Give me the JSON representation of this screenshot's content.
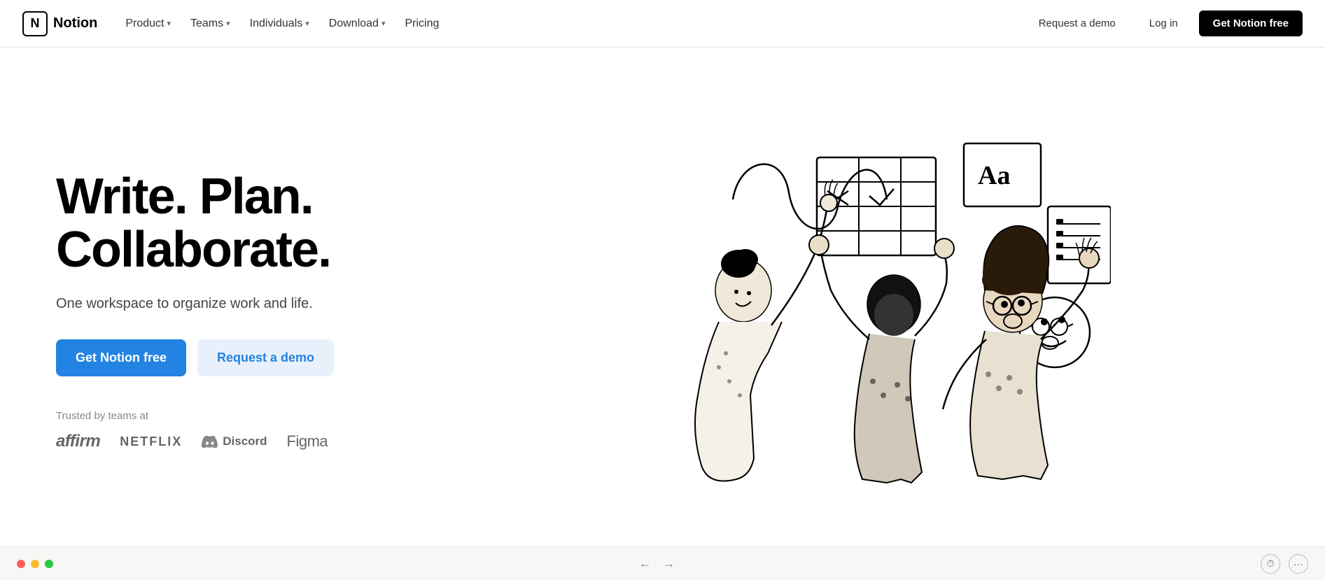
{
  "nav": {
    "logo_text": "Notion",
    "logo_letter": "N",
    "items": [
      {
        "id": "product",
        "label": "Product",
        "has_chevron": true
      },
      {
        "id": "teams",
        "label": "Teams",
        "has_chevron": true
      },
      {
        "id": "individuals",
        "label": "Individuals",
        "has_chevron": true
      },
      {
        "id": "download",
        "label": "Download",
        "has_chevron": true
      },
      {
        "id": "pricing",
        "label": "Pricing",
        "has_chevron": false
      }
    ],
    "request_demo_label": "Request a demo",
    "login_label": "Log in",
    "get_free_label": "Get Notion free"
  },
  "hero": {
    "headline": "Write. Plan.\nCollaborate.",
    "subtext": "One workspace to organize work and life.",
    "cta_primary": "Get Notion free",
    "cta_secondary": "Request a demo",
    "trusted_label": "Trusted by teams at",
    "logos": [
      "affirm",
      "NETFLIX",
      "Discord",
      "Figma"
    ]
  },
  "bottom_bar": {
    "back_arrow": "←",
    "forward_arrow": "→"
  }
}
